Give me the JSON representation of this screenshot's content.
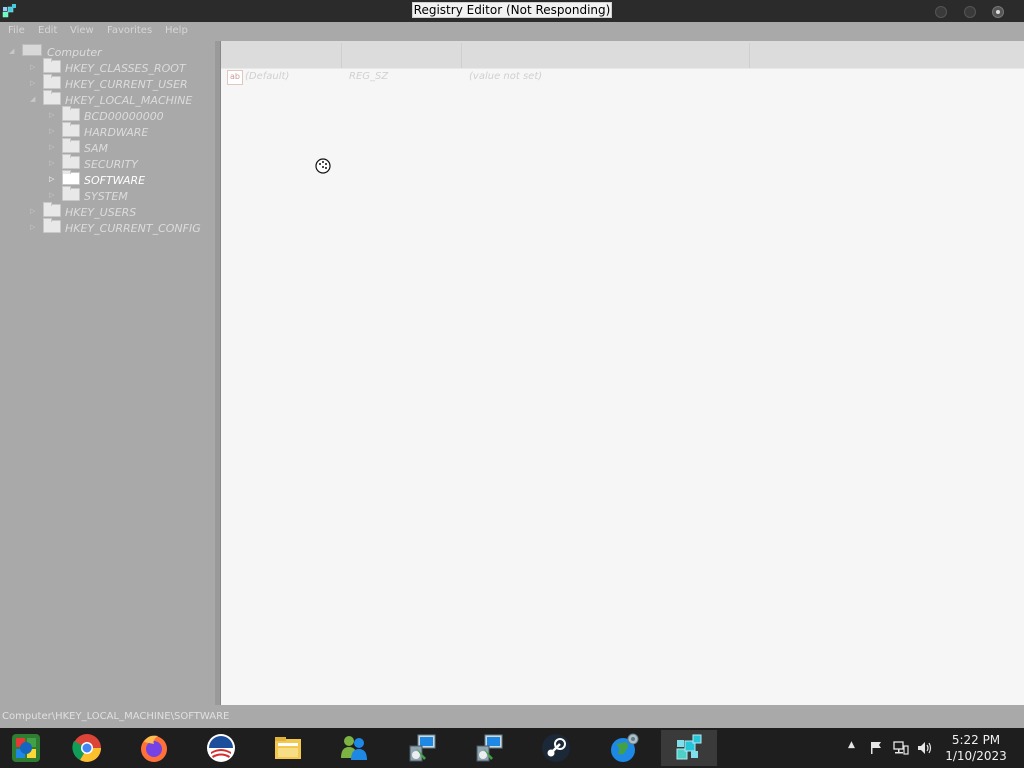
{
  "window": {
    "title": "Registry Editor (Not Responding)"
  },
  "menu": {
    "items": [
      "File",
      "Edit",
      "View",
      "Favorites",
      "Help"
    ]
  },
  "tree": {
    "root": "Computer",
    "nodes": [
      {
        "label": "HKEY_CLASSES_ROOT"
      },
      {
        "label": "HKEY_CURRENT_USER"
      },
      {
        "label": "HKEY_LOCAL_MACHINE"
      },
      {
        "label": "BCD00000000"
      },
      {
        "label": "HARDWARE"
      },
      {
        "label": "SAM"
      },
      {
        "label": "SECURITY"
      },
      {
        "label": "SOFTWARE"
      },
      {
        "label": "SYSTEM"
      },
      {
        "label": "HKEY_USERS"
      },
      {
        "label": "HKEY_CURRENT_CONFIG"
      }
    ],
    "selected": "SOFTWARE"
  },
  "values": {
    "rows": [
      {
        "icon": "ab",
        "name": "(Default)",
        "type": "REG_SZ",
        "data": "(value not set)"
      }
    ]
  },
  "status": {
    "path": "Computer\\HKEY_LOCAL_MACHINE\\SOFTWARE"
  },
  "taskbar": {
    "apps": [
      {
        "icon": "start-orb-icon"
      },
      {
        "icon": "chrome-icon"
      },
      {
        "icon": "firefox-icon"
      },
      {
        "icon": "obama-logo-icon"
      },
      {
        "icon": "file-explorer-icon"
      },
      {
        "icon": "messenger-icon"
      },
      {
        "icon": "setup-installer-icon"
      },
      {
        "icon": "setup-installer-icon"
      },
      {
        "icon": "steam-icon"
      },
      {
        "icon": "globe-settings-icon"
      },
      {
        "icon": "registry-editor-icon"
      }
    ],
    "clock": {
      "time": "5:22 PM",
      "date": "1/10/2023"
    }
  },
  "colors": {
    "titlebar": "#2b2b2b",
    "window_bg": "#a9a9a9",
    "values_bg": "#f6f6f6",
    "taskbar": "#1e1e1e"
  }
}
